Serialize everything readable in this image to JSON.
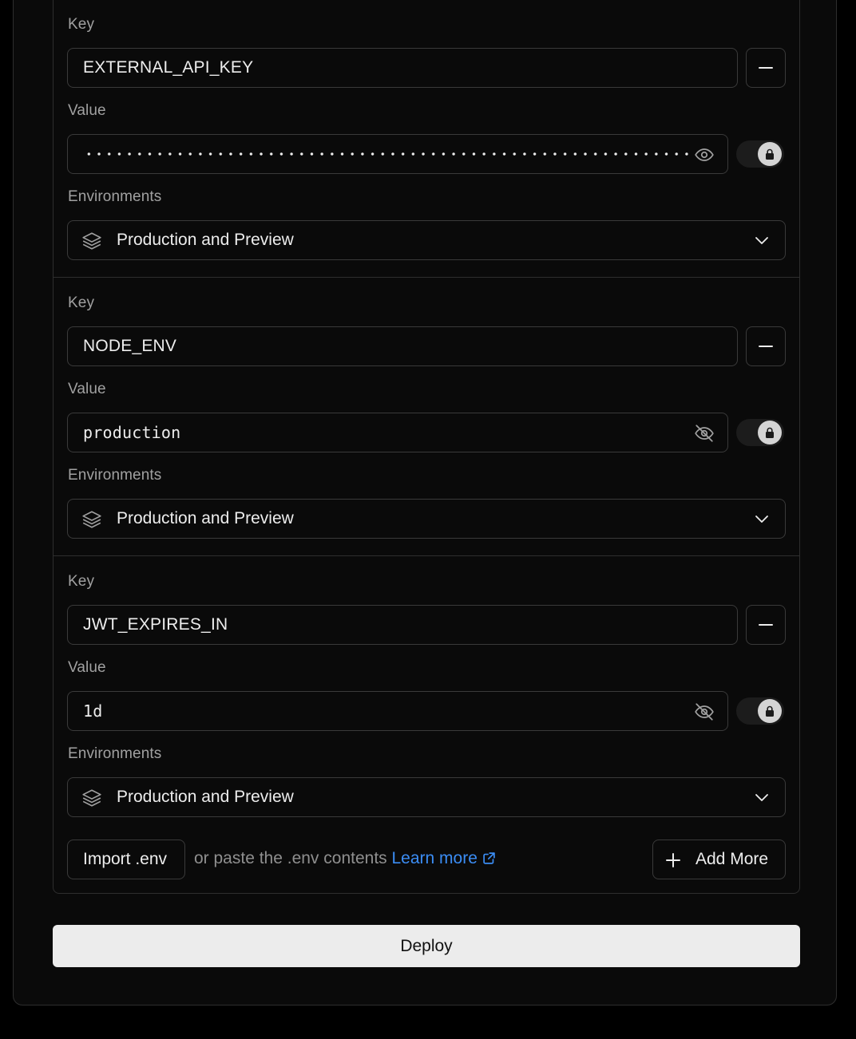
{
  "env_vars": [
    {
      "key_label": "Key",
      "key": "EXTERNAL_API_KEY",
      "value_label": "Value",
      "value": "",
      "value_hidden": true,
      "env_label": "Environments",
      "environments": "Production and Preview"
    },
    {
      "key_label": "Key",
      "key": "NODE_ENV",
      "value_label": "Value",
      "value": "production",
      "value_hidden": false,
      "env_label": "Environments",
      "environments": "Production and Preview"
    },
    {
      "key_label": "Key",
      "key": "JWT_EXPIRES_IN",
      "value_label": "Value",
      "value": "1d",
      "value_hidden": false,
      "env_label": "Environments",
      "environments": "Production and Preview"
    }
  ],
  "footer": {
    "import_label": "Import .env",
    "paste_hint": "or paste the .env contents",
    "learn_more": "Learn more",
    "add_more_label": "Add More"
  },
  "deploy_label": "Deploy",
  "colors": {
    "background": "#000000",
    "card": "#0a0a0a",
    "border": "#3a3a3a",
    "link": "#3b8df5",
    "deploy_bg": "#ececec"
  },
  "icons": [
    "minus-icon",
    "eye-icon",
    "eye-off-icon",
    "lock-icon",
    "layers-icon",
    "chevron-down-icon",
    "external-link-icon",
    "plus-icon"
  ]
}
